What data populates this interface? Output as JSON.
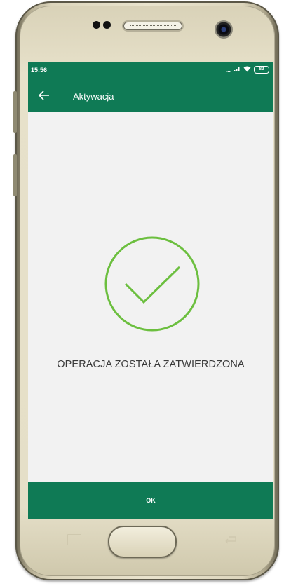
{
  "status_bar": {
    "time": "15:56",
    "signal_text": "...",
    "battery_level": "82"
  },
  "app_bar": {
    "title": "Aktywacja",
    "back_icon": "arrow-left-icon"
  },
  "content": {
    "success_icon": "check-circle-icon",
    "message": "OPERACJA ZOSTAŁA ZATWIERDZONA"
  },
  "footer": {
    "ok_label": "OK"
  },
  "colors": {
    "brand_green": "#0f7a55",
    "check_green": "#6cbf3f",
    "background": "#f2f2f2"
  }
}
